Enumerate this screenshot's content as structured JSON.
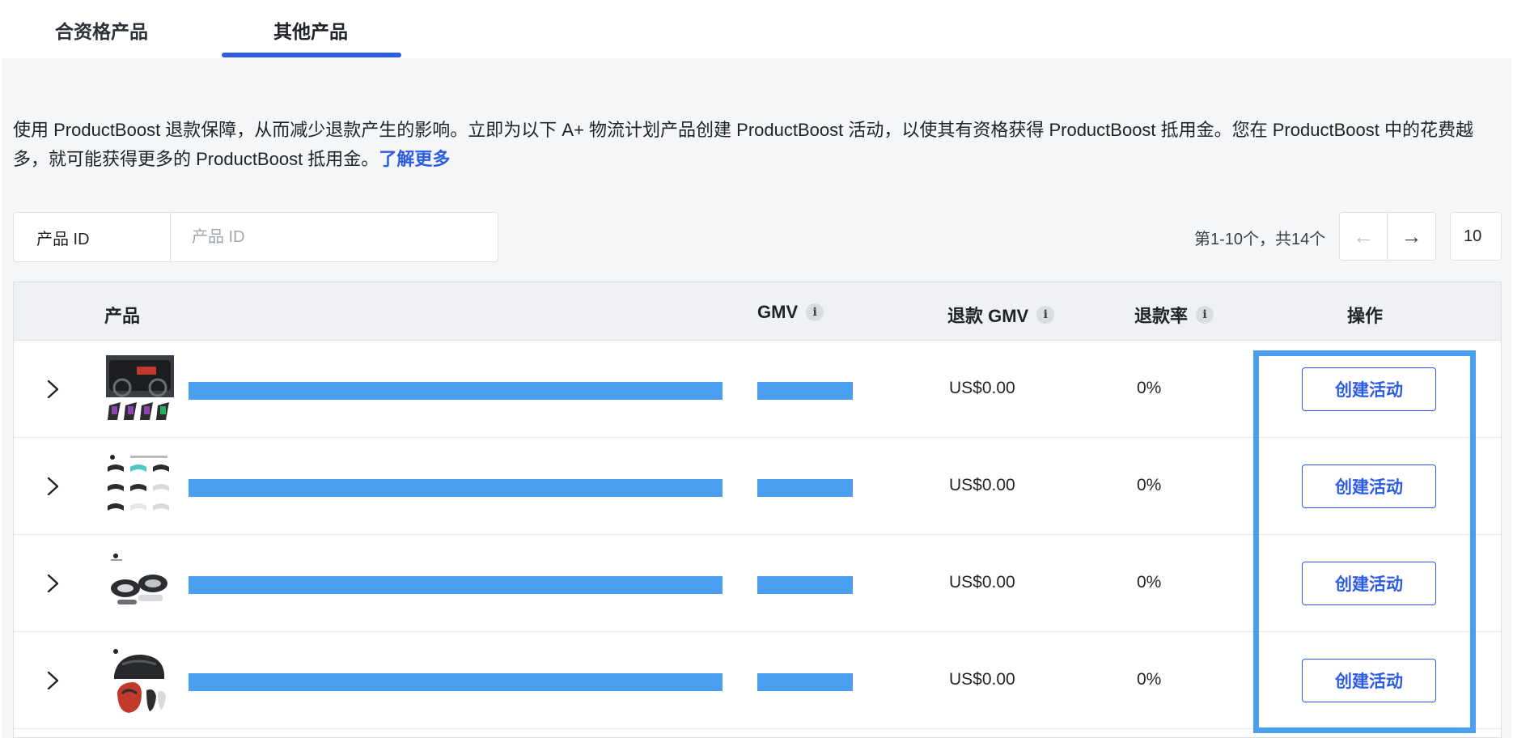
{
  "tabs": [
    {
      "label": "合资格产品",
      "active": false
    },
    {
      "label": "其他产品",
      "active": true
    }
  ],
  "description": {
    "text": "使用 ProductBoost 退款保障，从而减少退款产生的影响。立即为以下 A+ 物流计划产品创建 ProductBoost 活动，以使其有资格获得 ProductBoost 抵用金。您在 ProductBoost 中的花费越多，就可能获得更多的 ProductBoost 抵用金。",
    "learn_more": "了解更多"
  },
  "search": {
    "label": "产品 ID",
    "placeholder": "产品 ID",
    "value": ""
  },
  "pager": {
    "range_text": "第1-10个，共14个",
    "page_size": "10"
  },
  "table": {
    "headers": {
      "product": "产品",
      "gmv": "GMV",
      "refund_gmv": "退款 GMV",
      "refund_rate": "退款率",
      "action": "操作"
    },
    "rows": [
      {
        "refund_gmv": "US$0.00",
        "refund_rate": "0%",
        "action": "创建活动"
      },
      {
        "refund_gmv": "US$0.00",
        "refund_rate": "0%",
        "action": "创建活动"
      },
      {
        "refund_gmv": "US$0.00",
        "refund_rate": "0%",
        "action": "创建活动"
      },
      {
        "refund_gmv": "US$0.00",
        "refund_rate": "0%",
        "action": "创建活动"
      }
    ]
  },
  "colors": {
    "accent": "#2d5be3",
    "redaction": "#4a9ff0",
    "panel_bg": "#f5f6f8"
  },
  "icons": [
    "chevron-left-icon",
    "chevron-right-icon",
    "info-icon",
    "chevron-right-expand-icon"
  ]
}
